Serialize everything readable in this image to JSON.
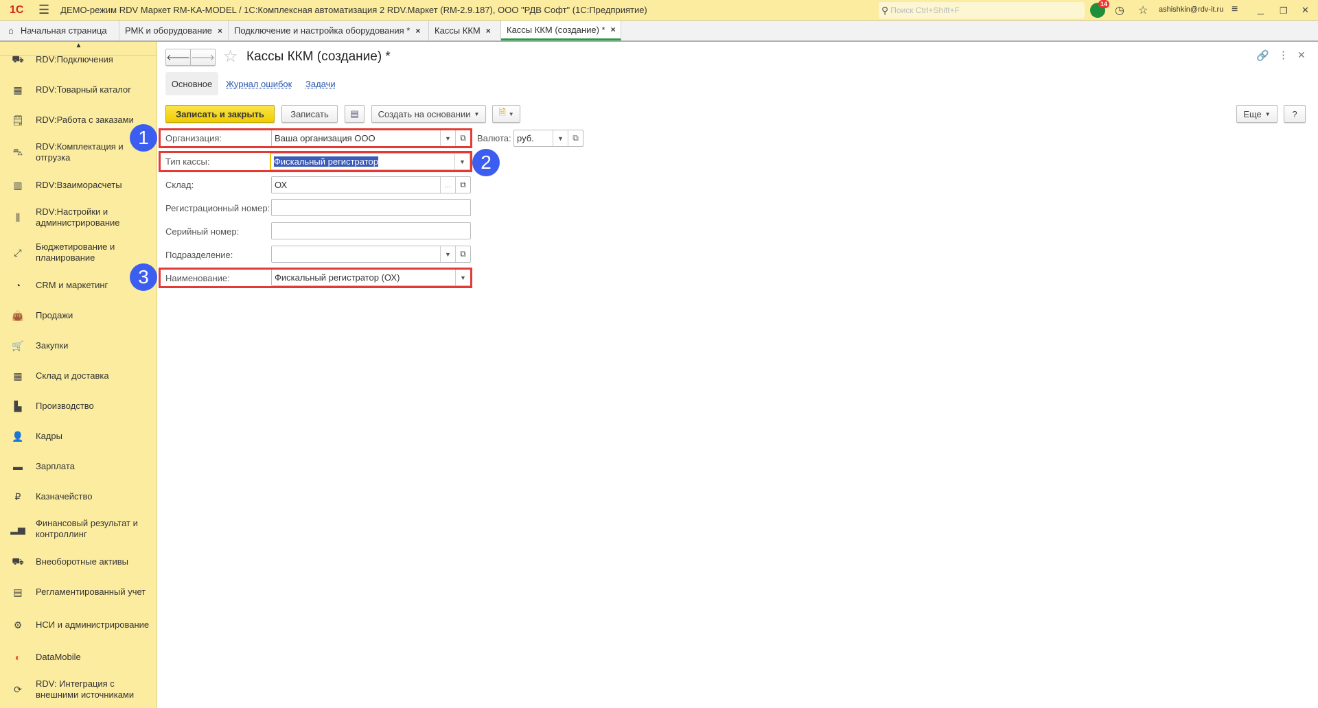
{
  "titlebar": {
    "logo": "1С",
    "title": "ДЕМО-режим RDV Маркет RM-KA-MODEL / 1С:Комплексная автоматизация 2 RDV.Маркет (RM-2.9.187), ООО \"РДВ Софт\"  (1С:Предприятие)",
    "search_placeholder": "Поиск Ctrl+Shift+F",
    "notifications": "14",
    "user": "ashishkin@rdv-it.ru"
  },
  "tabs": [
    {
      "label": "Начальная страница"
    },
    {
      "label": "РМК и оборудование"
    },
    {
      "label": "Подключение и настройка оборудования *"
    },
    {
      "label": "Кассы ККМ"
    },
    {
      "label": "Кассы ККМ (создание) *"
    }
  ],
  "sidebar": {
    "items": [
      {
        "label": "RDV:Подключения",
        "icon": "plug-icon"
      },
      {
        "label": "RDV:Товарный каталог",
        "icon": "catalog-icon"
      },
      {
        "label": "RDV:Работа с заказами",
        "icon": "orders-icon"
      },
      {
        "label": "RDV:Комплектация и отгрузка",
        "icon": "cart-dolly-icon"
      },
      {
        "label": "RDV:Взаиморасчеты",
        "icon": "calculator-icon"
      },
      {
        "label": "RDV:Настройки и администрирование",
        "icon": "sliders-icon"
      },
      {
        "label": "Бюджетирование и планирование",
        "icon": "budget-icon"
      },
      {
        "label": "CRM и маркетинг",
        "icon": "pie-icon"
      },
      {
        "label": "Продажи",
        "icon": "bag-icon"
      },
      {
        "label": "Закупки",
        "icon": "cart-icon"
      },
      {
        "label": "Склад и доставка",
        "icon": "warehouse-icon"
      },
      {
        "label": "Производство",
        "icon": "factory-icon"
      },
      {
        "label": "Кадры",
        "icon": "person-icon"
      },
      {
        "label": "Зарплата",
        "icon": "card-icon"
      },
      {
        "label": "Казначейство",
        "icon": "ruble-icon"
      },
      {
        "label": "Финансовый результат и контроллинг",
        "icon": "bar-chart-icon"
      },
      {
        "label": "Внеоборотные активы",
        "icon": "truck-icon"
      },
      {
        "label": "Регламентированный учет",
        "icon": "register-icon"
      },
      {
        "label": "НСИ и администрирование",
        "icon": "gear-icon"
      },
      {
        "label": "DataMobile",
        "icon": "datamobile-icon"
      },
      {
        "label": "RDV: Интеграция с внешними источниками",
        "icon": "sync-icon"
      }
    ]
  },
  "form": {
    "title": "Кассы ККМ (создание) *",
    "subtabs": [
      "Основное",
      "Журнал ошибок",
      "Задачи"
    ],
    "toolbar": {
      "save_close": "Записать и закрыть",
      "save": "Записать",
      "create_based": "Создать на основании",
      "more": "Еще",
      "help": "?"
    },
    "fields": {
      "org": {
        "label": "Организация:",
        "value": "Ваша организация ООО"
      },
      "currency": {
        "label": "Валюта:",
        "value": "руб."
      },
      "type": {
        "label": "Тип кассы:",
        "value": "Фискальный регистратор"
      },
      "warehouse": {
        "label": "Склад:",
        "value": "ОХ"
      },
      "regnum": {
        "label": "Регистрационный номер:",
        "value": ""
      },
      "serial": {
        "label": "Серийный номер:",
        "value": ""
      },
      "division": {
        "label": "Подразделение:",
        "value": ""
      },
      "name": {
        "label": "Наименование:",
        "value": "Фискальный регистратор (ОХ)"
      }
    }
  },
  "annotations": [
    "1",
    "2",
    "3"
  ],
  "colors": {
    "annotation_box": "#e53935",
    "annotation_circle": "#3c5ef0",
    "sidebar_bg": "#fbeca0",
    "primary_button": "#f0cc00"
  }
}
